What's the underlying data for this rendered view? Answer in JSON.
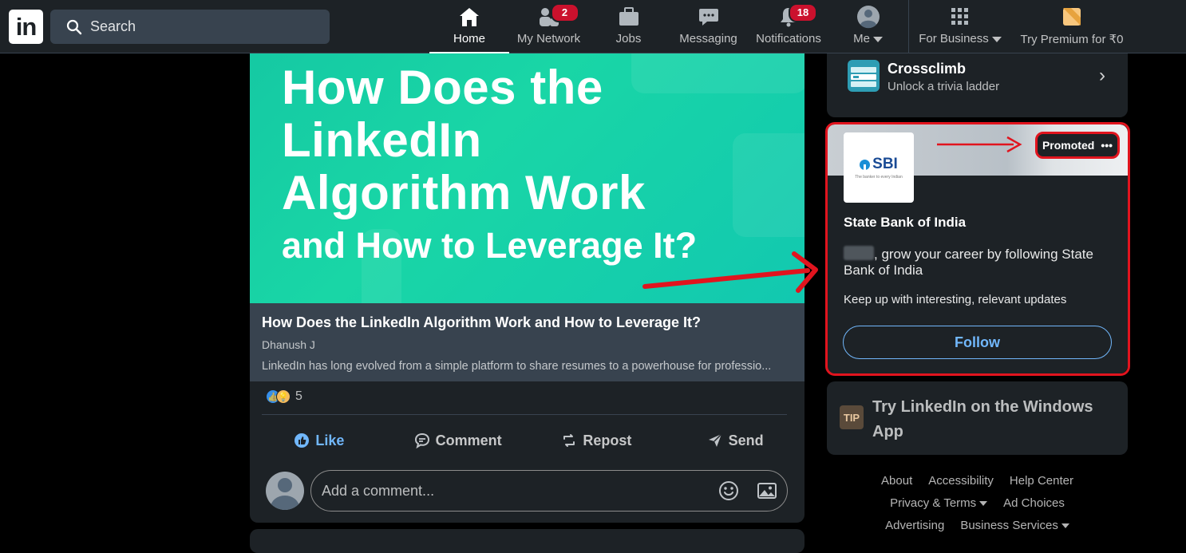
{
  "topbar": {
    "search_placeholder": "Search",
    "nav": [
      {
        "label": "Home",
        "badge": ""
      },
      {
        "label": "My Network",
        "badge": "2"
      },
      {
        "label": "Jobs",
        "badge": ""
      },
      {
        "label": "Messaging",
        "badge": ""
      },
      {
        "label": "Notifications",
        "badge": "18"
      },
      {
        "label": "Me",
        "badge": ""
      }
    ],
    "for_business": "For Business",
    "premium": "Try Premium for ₹0",
    "logo_text": "in"
  },
  "post": {
    "hero_lines": [
      "How Does the",
      "LinkedIn",
      "Algorithm Work",
      "and How to Leverage It?"
    ],
    "article_title": "How Does the LinkedIn Algorithm Work and How to Leverage It?",
    "article_author": "Dhanush J",
    "article_desc": "LinkedIn has long evolved from a simple platform to share resumes to a powerhouse for professio...",
    "reaction_count": "5",
    "actions": {
      "like": "Like",
      "comment": "Comment",
      "repost": "Repost",
      "send": "Send"
    },
    "comment_placeholder": "Add a comment..."
  },
  "sidebar": {
    "crossclimb": {
      "title": "Crossclimb",
      "subtitle": "Unlock a trivia ladder"
    },
    "ad": {
      "promoted": "Promoted",
      "logo_text": "SBI",
      "logo_tagline": "The banker to every Indian",
      "company": "State Bank of India",
      "message": ", grow your career by following State Bank of India",
      "subtext": "Keep up with interesting, relevant updates",
      "follow": "Follow"
    },
    "tip": {
      "badge": "TIP",
      "text": "Try LinkedIn on the Windows App"
    },
    "footer": {
      "row1": [
        "About",
        "Accessibility",
        "Help Center"
      ],
      "row2": [
        "Privacy & Terms",
        "Ad Choices"
      ],
      "row3": [
        "Advertising",
        "Business Services"
      ]
    }
  },
  "colors": {
    "accent": "#71b7fb",
    "annotation": "#e1141e",
    "badge": "#cb112d",
    "background": "#1d2226"
  }
}
